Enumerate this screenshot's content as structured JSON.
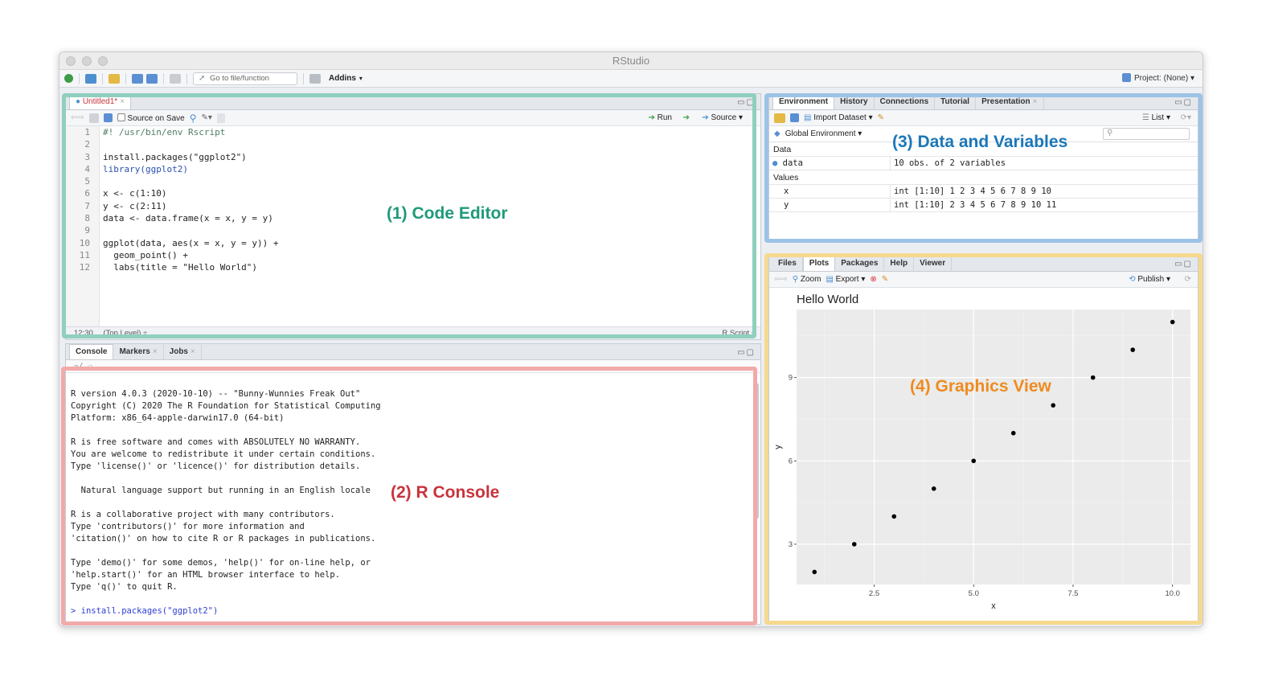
{
  "window": {
    "title": "RStudio"
  },
  "toolbar": {
    "goto_placeholder": "Go to file/function",
    "addins": "Addins",
    "project": "Project: (None)"
  },
  "editor": {
    "tab": "Untitled1*",
    "source_on_save": "Source on Save",
    "run": "Run",
    "source": "Source",
    "lines": [
      {
        "n": "1",
        "t": "#! /usr/bin/env Rscript"
      },
      {
        "n": "2",
        "t": ""
      },
      {
        "n": "3",
        "t": "install.packages(\"ggplot2\")"
      },
      {
        "n": "4",
        "t": "library(ggplot2)"
      },
      {
        "n": "5",
        "t": ""
      },
      {
        "n": "6",
        "t": "x <- c(1:10)"
      },
      {
        "n": "7",
        "t": "y <- c(2:11)"
      },
      {
        "n": "8",
        "t": "data <- data.frame(x = x, y = y)"
      },
      {
        "n": "9",
        "t": ""
      },
      {
        "n": "10",
        "t": "ggplot(data, aes(x = x, y = y)) +"
      },
      {
        "n": "11",
        "t": "  geom_point() +"
      },
      {
        "n": "12",
        "t": "  labs(title = \"Hello World\")"
      }
    ],
    "status_pos": "12:30",
    "status_level": "(Top Level) ÷",
    "status_type": "R Script ÷"
  },
  "console": {
    "tabs": [
      "Console",
      "Markers",
      "Jobs"
    ],
    "path": "~/",
    "lines": [
      "",
      "R version 4.0.3 (2020-10-10) -- \"Bunny-Wunnies Freak Out\"",
      "Copyright (C) 2020 The R Foundation for Statistical Computing",
      "Platform: x86_64-apple-darwin17.0 (64-bit)",
      "",
      "R is free software and comes with ABSOLUTELY NO WARRANTY.",
      "You are welcome to redistribute it under certain conditions.",
      "Type 'license()' or 'licence()' for distribution details.",
      "",
      "  Natural language support but running in an English locale",
      "",
      "R is a collaborative project with many contributors.",
      "Type 'contributors()' for more information and",
      "'citation()' on how to cite R or R packages in publications.",
      "",
      "Type 'demo()' for some demos, 'help()' for on-line help, or",
      "'help.start()' for an HTML browser interface to help.",
      "Type 'q()' to quit R.",
      ""
    ],
    "prompt": "> install.packages(\"ggplot2\")"
  },
  "environment": {
    "tabs": [
      "Environment",
      "History",
      "Connections",
      "Tutorial",
      "Presentation"
    ],
    "import_dataset": "Import Dataset",
    "list": "List",
    "scope": "Global Environment",
    "section_data": "Data",
    "section_values": "Values",
    "data_rows": [
      {
        "name": "data",
        "value": "10 obs. of 2 variables"
      }
    ],
    "value_rows": [
      {
        "name": "x",
        "value": "int [1:10] 1 2 3 4 5 6 7 8 9 10"
      },
      {
        "name": "y",
        "value": "int [1:10] 2 3 4 5 6 7 8 9 10 11"
      }
    ]
  },
  "files": {
    "tabs": [
      "Files",
      "Plots",
      "Packages",
      "Help",
      "Viewer"
    ],
    "zoom": "Zoom",
    "export": "Export",
    "publish": "Publish"
  },
  "annotations": {
    "code_editor": "(1) Code Editor",
    "r_console": "(2) R Console",
    "data_variables": "(3) Data and Variables",
    "graphics_view": "(4) Graphics View"
  },
  "colors": {
    "editor_box": "#8fcfbe",
    "console_box": "#f2a9a9",
    "env_box": "#9cc3e6",
    "graphics_box": "#f5d98e",
    "editor_label": "#1f9a7a",
    "console_label": "#c8343c",
    "env_label": "#1b77b8",
    "graphics_label": "#ee8b1f"
  },
  "chart_data": {
    "type": "scatter",
    "title": "Hello World",
    "xlabel": "x",
    "ylabel": "y",
    "x": [
      1,
      2,
      3,
      4,
      5,
      6,
      7,
      8,
      9,
      10
    ],
    "y": [
      2,
      3,
      4,
      5,
      6,
      7,
      8,
      9,
      10,
      11
    ],
    "xlim": [
      0.55,
      10.45
    ],
    "ylim": [
      1.55,
      11.45
    ],
    "xticks": [
      "2.5",
      "5.0",
      "7.5",
      "10.0"
    ],
    "yticks": [
      "3",
      "6",
      "9"
    ],
    "grid": true
  }
}
